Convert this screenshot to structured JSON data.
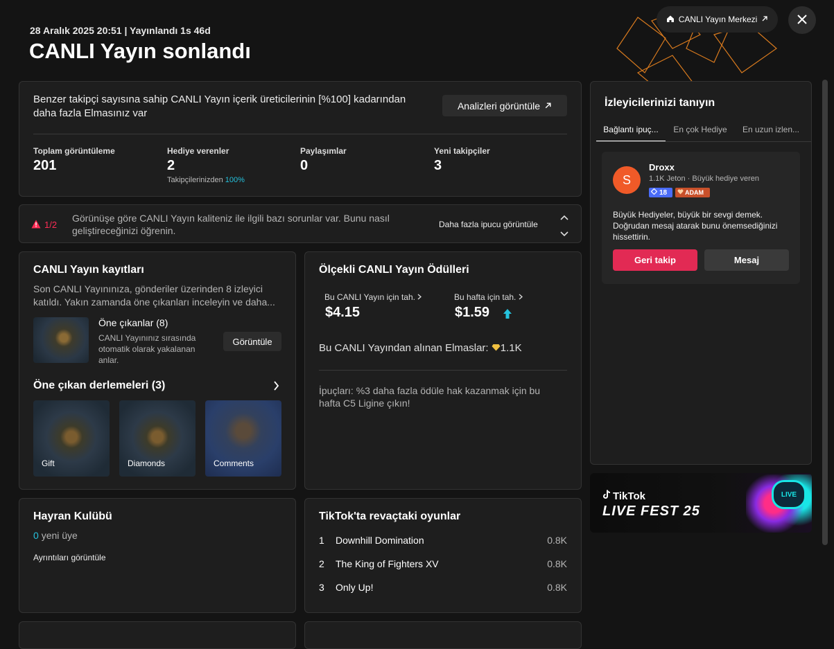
{
  "header": {
    "meta": "28 Aralık 2025 20:51 | Yayınlandı 1s 46d",
    "title": "CANLI Yayın sonlandı",
    "live_center_label": "CANLI Yayın Merkezi"
  },
  "summary": {
    "text": "Benzer takipçi sayısına sahip CANLI Yayın içerik üreticilerinin [%100] kadarından daha fazla Elmasınız var",
    "analytics_button": "Analizleri görüntüle",
    "stats": [
      {
        "label": "Toplam görüntüleme",
        "value": "201"
      },
      {
        "label": "Hediye verenler",
        "value": "2",
        "sub_prefix": "Takipçilerinizden",
        "sub_value": "100%"
      },
      {
        "label": "Paylaşımlar",
        "value": "0"
      },
      {
        "label": "Yeni takipçiler",
        "value": "3"
      }
    ]
  },
  "quality": {
    "counter": "1/2",
    "text": "Görünüşe göre CANLI Yayın kaliteniz ile ilgili bazı sorunlar var. Bunu nasıl geliştireceğinizi öğrenin.",
    "tips_link": "Daha fazla ipucu görüntüle"
  },
  "recordings": {
    "title": "CANLI Yayın kayıtları",
    "desc": "Son CANLI Yayınınıza, gönderiler üzerinden 8 izleyici katıldı. Yakın zamanda öne çıkanları inceleyin ve daha...",
    "highlights_title": "Öne çıkanlar (8)",
    "highlights_desc": "CANLI Yayınınız sırasında otomatik olarak yakalanan anlar.",
    "view_button": "Görüntüle",
    "compilations_title": "Öne çıkan derlemeleri (3)",
    "compilations": [
      {
        "label": "Gift"
      },
      {
        "label": "Diamonds"
      },
      {
        "label": "Comments"
      }
    ]
  },
  "rewards": {
    "title": "Ölçekli CANLI Yayın Ödülleri",
    "this_live_label": "Bu CANLI Yayın için tah.",
    "this_live_value": "$4.15",
    "this_week_label": "Bu hafta için tah.",
    "this_week_value": "$1.59",
    "diamonds_label": "Bu CANLI Yayından alınan Elmaslar:",
    "diamonds_value": "1.1K",
    "tip": "İpuçları: %3 daha fazla ödüle hak kazanmak için bu hafta C5 Ligine çıkın!"
  },
  "fan_club": {
    "title": "Hayran Kulübü",
    "count": "0",
    "count_suffix": "yeni üye",
    "details_link": "Ayrıntıları görüntüle"
  },
  "trending_games": {
    "title": "TikTok'ta revaçtaki oyunlar",
    "items": [
      {
        "rank": "1",
        "name": "Downhill Domination",
        "value": "0.8K"
      },
      {
        "rank": "2",
        "name": "The King of Fighters XV",
        "value": "0.8K"
      },
      {
        "rank": "3",
        "name": "Only Up!",
        "value": "0.8K"
      }
    ]
  },
  "viewers": {
    "title": "İzleyicilerinizi tanıyın",
    "tabs": [
      "Bağlantı ipuç...",
      "En çok Hediye",
      "En uzun izlen..."
    ],
    "user": {
      "initial": "S",
      "name": "Droxx",
      "meta": "1.1K Jeton · Büyük hediye veren",
      "level": "18",
      "badge": "ADAM"
    },
    "message": "Büyük Hediyeler, büyük bir sevgi demek. Doğrudan mesaj atarak bunu önemsediğinizi hissettirin.",
    "follow_back": "Geri takip",
    "message_button": "Mesaj"
  },
  "banner": {
    "brand": "TikTok",
    "event": "LIVE FEST 25",
    "bubble": "LIVE"
  },
  "colors": {
    "accent": "#fe2c55",
    "teal": "#25c2dd",
    "avatar": "#f05a28",
    "level_badge": "#4a6cf7",
    "adam_badge": "#c8502a"
  }
}
